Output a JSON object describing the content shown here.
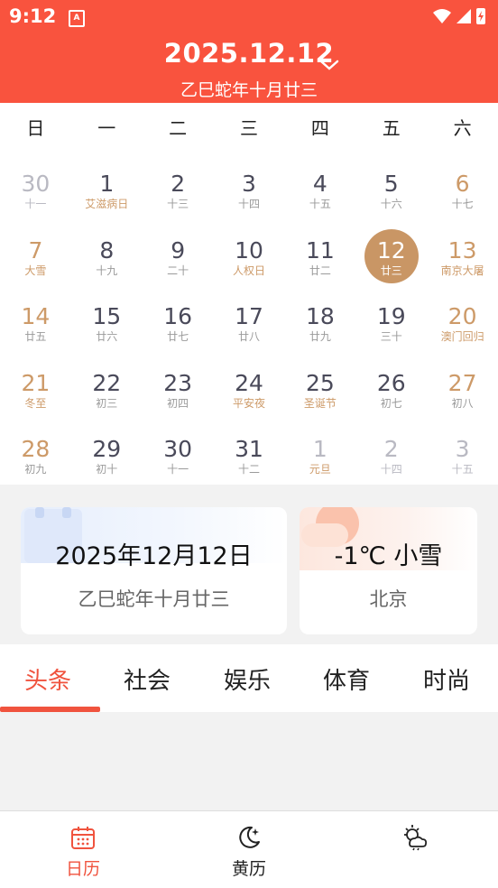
{
  "status_bar": {
    "time": "9:12",
    "notification_glyph": "A"
  },
  "header": {
    "date_title": "2025.12.12",
    "lunar_title": "乙巳蛇年十月廿三"
  },
  "weekdays": [
    "日",
    "一",
    "二",
    "三",
    "四",
    "五",
    "六"
  ],
  "calendar": {
    "weeks": [
      [
        {
          "num": "30",
          "sub": "十一",
          "type": "other"
        },
        {
          "num": "1",
          "sub": "艾滋病日",
          "type": "festival"
        },
        {
          "num": "2",
          "sub": "十三",
          "type": "normal"
        },
        {
          "num": "3",
          "sub": "十四",
          "type": "normal"
        },
        {
          "num": "4",
          "sub": "十五",
          "type": "normal"
        },
        {
          "num": "5",
          "sub": "十六",
          "type": "normal"
        },
        {
          "num": "6",
          "sub": "十七",
          "type": "weekend"
        }
      ],
      [
        {
          "num": "7",
          "sub": "大雪",
          "type": "weekend festival"
        },
        {
          "num": "8",
          "sub": "十九",
          "type": "normal"
        },
        {
          "num": "9",
          "sub": "二十",
          "type": "normal"
        },
        {
          "num": "10",
          "sub": "人权日",
          "type": "festival"
        },
        {
          "num": "11",
          "sub": "廿二",
          "type": "normal"
        },
        {
          "num": "12",
          "sub": "廿三",
          "type": "selected"
        },
        {
          "num": "13",
          "sub": "南京大屠",
          "type": "weekend festival"
        }
      ],
      [
        {
          "num": "14",
          "sub": "廿五",
          "type": "weekend"
        },
        {
          "num": "15",
          "sub": "廿六",
          "type": "normal"
        },
        {
          "num": "16",
          "sub": "廿七",
          "type": "normal"
        },
        {
          "num": "17",
          "sub": "廿八",
          "type": "normal"
        },
        {
          "num": "18",
          "sub": "廿九",
          "type": "normal"
        },
        {
          "num": "19",
          "sub": "三十",
          "type": "normal"
        },
        {
          "num": "20",
          "sub": "澳门回归",
          "type": "weekend festival"
        }
      ],
      [
        {
          "num": "21",
          "sub": "冬至",
          "type": "weekend festival"
        },
        {
          "num": "22",
          "sub": "初三",
          "type": "normal"
        },
        {
          "num": "23",
          "sub": "初四",
          "type": "normal"
        },
        {
          "num": "24",
          "sub": "平安夜",
          "type": "festival"
        },
        {
          "num": "25",
          "sub": "圣诞节",
          "type": "festival"
        },
        {
          "num": "26",
          "sub": "初七",
          "type": "normal"
        },
        {
          "num": "27",
          "sub": "初八",
          "type": "weekend"
        }
      ],
      [
        {
          "num": "28",
          "sub": "初九",
          "type": "weekend"
        },
        {
          "num": "29",
          "sub": "初十",
          "type": "normal"
        },
        {
          "num": "30",
          "sub": "十一",
          "type": "normal"
        },
        {
          "num": "31",
          "sub": "十二",
          "type": "normal"
        },
        {
          "num": "1",
          "sub": "元旦",
          "type": "other festival"
        },
        {
          "num": "2",
          "sub": "十四",
          "type": "other"
        },
        {
          "num": "3",
          "sub": "十五",
          "type": "other"
        }
      ]
    ]
  },
  "date_card": {
    "main": "2025年12月12日",
    "sub": "乙巳蛇年十月廿三"
  },
  "weather_card": {
    "main": "-1℃ 小雪",
    "sub": "北京"
  },
  "news_tabs": [
    "头条",
    "社会",
    "娱乐",
    "体育",
    "时尚"
  ],
  "bottom_nav": [
    {
      "label": "日历",
      "icon": "calendar-icon",
      "active": true
    },
    {
      "label": "黄历",
      "icon": "moon-icon",
      "active": false
    },
    {
      "label": "",
      "icon": "weather-icon",
      "active": false
    }
  ],
  "colors": {
    "header": "#f9533e",
    "accent": "#f0533e",
    "selected": "#c99665",
    "festival": "#cd9a68"
  }
}
